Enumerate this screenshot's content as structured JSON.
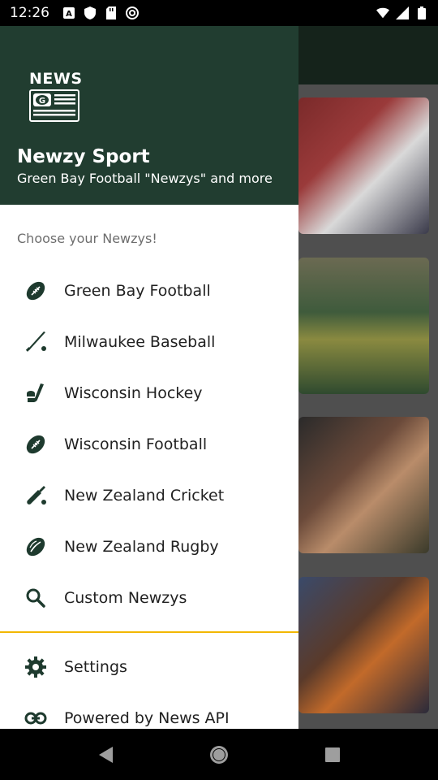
{
  "status_bar": {
    "time": "12:26",
    "icons_left": [
      "a-icon",
      "shield-icon",
      "sd-card-icon",
      "at-icon"
    ],
    "icons_right": [
      "wifi-icon",
      "signal-icon",
      "battery-icon"
    ]
  },
  "drawer": {
    "logo_text": "NEWS",
    "app_title": "Newzy Sport",
    "app_subtitle": "Green Bay Football \"Newzys\" and more",
    "section_label": "Choose your Newzys!",
    "items": [
      {
        "label": "Green Bay Football",
        "icon": "football-icon"
      },
      {
        "label": "Milwaukee Baseball",
        "icon": "baseball-bat-icon"
      },
      {
        "label": "Wisconsin Hockey",
        "icon": "hockey-icon"
      },
      {
        "label": "Wisconsin Football",
        "icon": "football-icon"
      },
      {
        "label": "New Zealand Cricket",
        "icon": "cricket-icon"
      },
      {
        "label": "New Zealand Rugby",
        "icon": "rugby-icon"
      },
      {
        "label": "Custom Newzys",
        "icon": "search-icon"
      }
    ],
    "bottom_items": [
      {
        "label": "Settings",
        "icon": "gear-icon"
      },
      {
        "label": "Powered by News API",
        "icon": "link-icon"
      }
    ]
  },
  "colors": {
    "header_bg": "#213d30",
    "divider": "#f2b700",
    "icon": "#1e3a2e"
  }
}
